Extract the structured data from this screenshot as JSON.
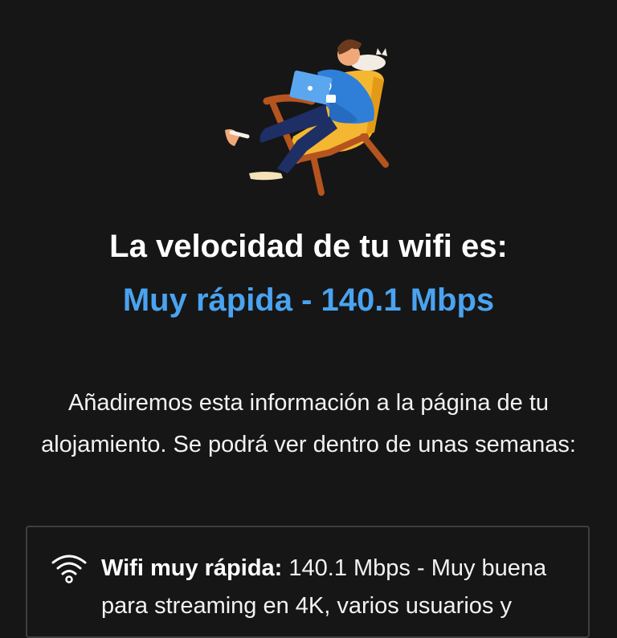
{
  "result": {
    "title": "La velocidad de tu wifi es:",
    "speed_text": "Muy rápida - 140.1 Mbps",
    "speed_color": "#4aa3f0"
  },
  "description": "Añadiremos esta información a la página de tu alojamiento. Se podrá ver dentro de unas semanas:",
  "card": {
    "icon": "wifi-icon",
    "label": "Wifi muy rápida:",
    "text": " 140.1 Mbps - Muy buena para streaming en 4K, varios usuarios y"
  },
  "illustration": "person-in-armchair-with-laptop-and-cat",
  "colors": {
    "background": "#161616",
    "accent": "#4aa3f0",
    "card_border": "#3f3f3f"
  }
}
